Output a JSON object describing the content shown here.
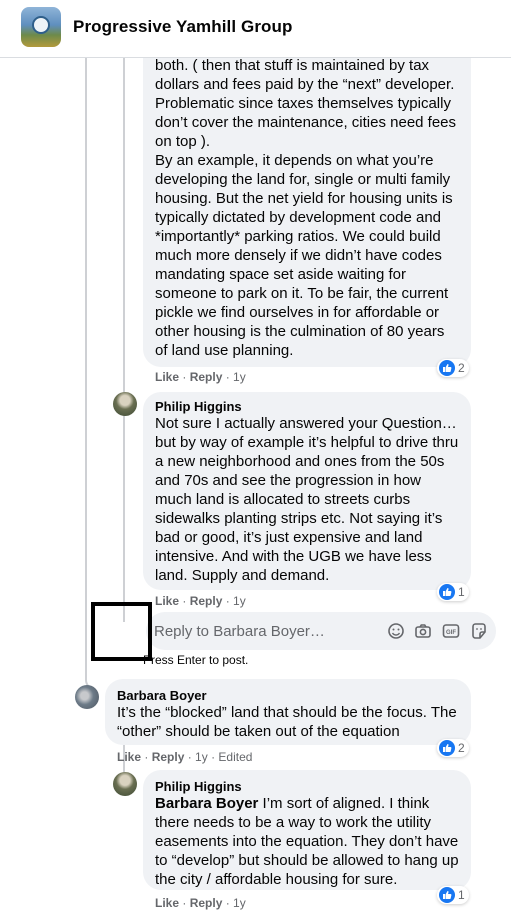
{
  "header": {
    "group_name": "Progressive Yamhill Group",
    "group_icon": "group-photo"
  },
  "comments": [
    {
      "author": "",
      "text": "both. ( then that stuff is maintained by tax dollars and fees paid by the “next” developer. Problematic since taxes themselves typically don’t cover the maintenance, cities need fees on top ).\nBy an example, it depends on what you’re developing the land for, single or multi family housing. But the net yield for housing units is typically dictated by development code and *importantly* parking ratios. We could build much more densely if we didn’t have codes mandating space set aside waiting for someone to park on it. To be fair, the current pickle we find ourselves in for affordable or other housing is the culmination of 80 years of land use planning.",
      "like": "Like",
      "reply": "Reply",
      "time": "1y",
      "reactions": "2"
    },
    {
      "author": "Philip Higgins",
      "text": "Not sure I actually answered your Question… but by way of example it’s helpful to drive thru a new neighborhood and ones from the 50s and 70s and see the progression in how much land is allocated to streets curbs sidewalks planting strips etc. Not saying it’s bad or good, it’s just expensive and land intensive. And with the UGB we have less land. Supply and demand.",
      "like": "Like",
      "reply": "Reply",
      "time": "1y",
      "reactions": "1"
    },
    {
      "author": "Barbara Boyer",
      "text": "It’s the “blocked” land that should be the focus. The “other” should be taken out of the equation",
      "like": "Like",
      "reply": "Reply",
      "time": "1y",
      "edited": "Edited",
      "reactions": "2"
    },
    {
      "author": "Philip Higgins",
      "mention": "Barbara Boyer",
      "text": " I’m sort of aligned. I think there needs to be a way to work the utility easements into the equation. They don’t have to “develop” but should be allowed to hang up the city / affordable housing for sure.",
      "like": "Like",
      "reply": "Reply",
      "time": "1y",
      "reactions": "1"
    }
  ],
  "reply_box": {
    "placeholder": "Reply to Barbara Boyer…",
    "hint": "Press Enter to post.",
    "icons": [
      "emoji-icon",
      "camera-icon",
      "gif-icon",
      "sticker-icon"
    ]
  },
  "colors": {
    "bubble": "#f0f2f5",
    "like_blue": "#1877f2",
    "meta": "#65676b"
  }
}
